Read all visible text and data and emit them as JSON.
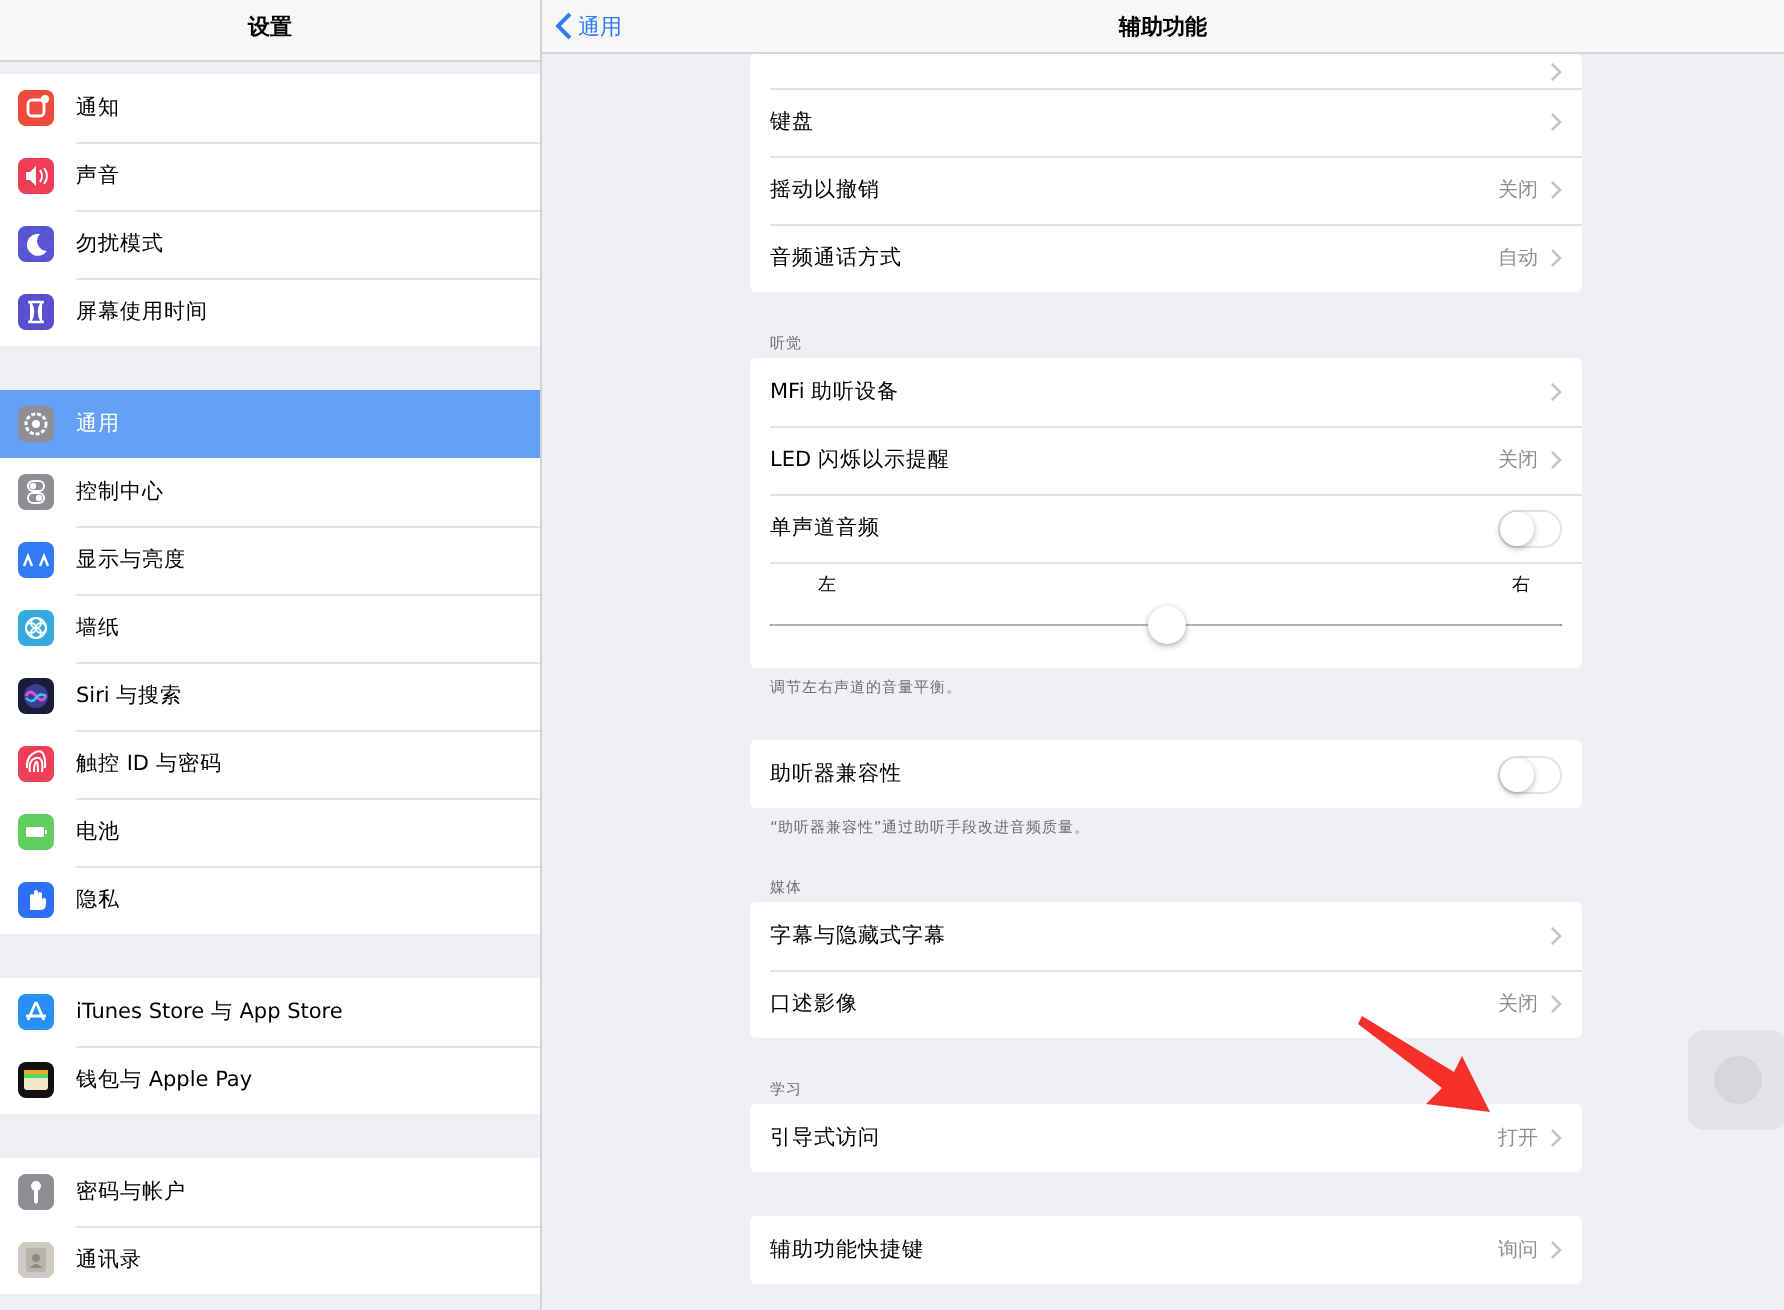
{
  "sidebar": {
    "title": "设置",
    "groups": [
      {
        "items": [
          {
            "label": "通知",
            "color": "#ef4a3d",
            "selected": false
          },
          {
            "label": "声音",
            "color": "#ee3f57",
            "selected": false
          },
          {
            "label": "勿扰模式",
            "color": "#5856d6",
            "selected": false
          },
          {
            "label": "屏幕使用时间",
            "color": "#5a4fcf",
            "selected": false
          }
        ]
      },
      {
        "items": [
          {
            "label": "通用",
            "color": "#8e8e93",
            "selected": true
          },
          {
            "label": "控制中心",
            "color": "#8e8e93",
            "selected": false
          },
          {
            "label": "显示与亮度",
            "color": "#2f7cf6",
            "selected": false
          },
          {
            "label": "墙纸",
            "color": "#36aadc",
            "selected": false
          },
          {
            "label": "Siri 与搜索",
            "color": "#1c1c3a",
            "selected": false
          },
          {
            "label": "触控 ID 与密码",
            "color": "#ee3f57",
            "selected": false
          },
          {
            "label": "电池",
            "color": "#5fcf5f",
            "selected": false
          },
          {
            "label": "隐私",
            "color": "#2f6ef6",
            "selected": false
          }
        ]
      },
      {
        "items": [
          {
            "label": "iTunes Store 与 App Store",
            "color": "#2a8ff5",
            "selected": false
          },
          {
            "label": "钱包与 Apple Pay",
            "color": "#111111",
            "selected": false
          }
        ]
      },
      {
        "items": [
          {
            "label": "密码与帐户",
            "color": "#8e8e93",
            "selected": false
          },
          {
            "label": "通讯录",
            "color": "#cfcbc2",
            "selected": false
          }
        ]
      }
    ]
  },
  "nav": {
    "back": "通用",
    "title": "辅助功能"
  },
  "groups": [
    {
      "partial": true,
      "rows": [
        {
          "kind": "link",
          "label": "键盘"
        },
        {
          "kind": "link",
          "label": "摇动以撤销",
          "value": "关闭"
        },
        {
          "kind": "link",
          "label": "音频通话方式",
          "value": "自动"
        }
      ]
    },
    {
      "header": "听觉",
      "footer": "调节左右声道的音量平衡。",
      "rows": [
        {
          "kind": "link",
          "label": "MFi 助听设备"
        },
        {
          "kind": "link",
          "label": "LED 闪烁以示提醒",
          "value": "关闭"
        },
        {
          "kind": "toggle",
          "label": "单声道音频",
          "on": false
        },
        {
          "kind": "slider",
          "left": "左",
          "right": "右",
          "level": 0.5
        }
      ]
    },
    {
      "footer": "“助听器兼容性”通过助听手段改进音频质量。",
      "rows": [
        {
          "kind": "toggle",
          "label": "助听器兼容性",
          "on": false
        }
      ]
    },
    {
      "header": "媒体",
      "rows": [
        {
          "kind": "link",
          "label": "字幕与隐藏式字幕"
        },
        {
          "kind": "link",
          "label": "口述影像",
          "value": "关闭"
        }
      ]
    },
    {
      "header": "学习",
      "rows": [
        {
          "kind": "link",
          "label": "引导式访问",
          "value": "打开"
        }
      ]
    },
    {
      "rows": [
        {
          "kind": "link",
          "label": "辅助功能快捷键",
          "value": "询问"
        }
      ]
    }
  ]
}
